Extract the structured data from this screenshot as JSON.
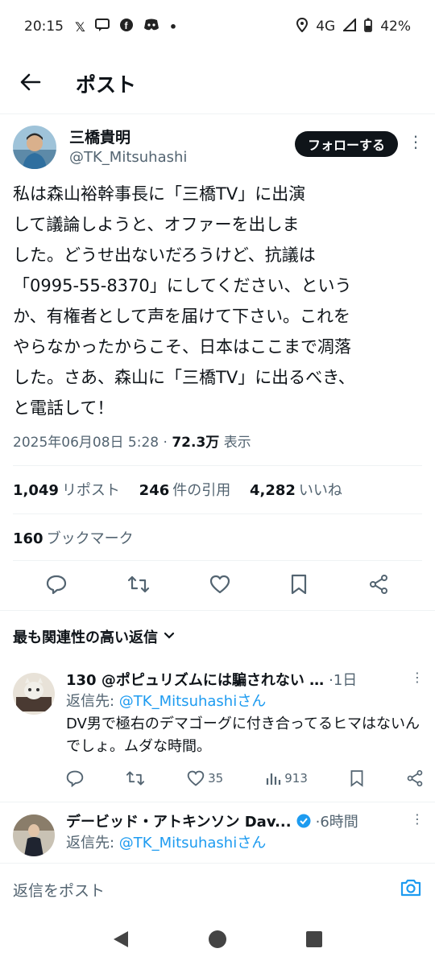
{
  "status": {
    "time": "20:15",
    "network": "4G",
    "battery": "42%"
  },
  "header": {
    "title": "ポスト"
  },
  "post": {
    "author_name": "三橋貴明",
    "author_handle": "@TK_Mitsuhashi",
    "follow_label": "フォローする",
    "text": "私は森山裕幹事長に「三橋TV」に出演\nして議論しようと、オファーを出しま\nした。どうせ出ないだろうけど、抗議は\n「0995-55-8370」にしてください、という\nか、有権者として声を届けて下さい。これを\nやらなかったからこそ、日本はここまで凋落\nした。さあ、森山に「三橋TV」に出るべき、\nと電話して！",
    "datetime": "2025年06月08日 5:28",
    "separator": "·",
    "views": "72.3万",
    "views_label": "表示",
    "reposts": "1,049",
    "reposts_label": "リポスト",
    "quotes": "246",
    "quotes_label": "件の引用",
    "likes": "4,282",
    "likes_label": "いいね",
    "bookmarks": "160",
    "bookmarks_label": "ブックマーク"
  },
  "replies_section": {
    "sort_label": "最も関連性の高い返信"
  },
  "replies": [
    {
      "name": "130 @ポピュリズムには騙されない …",
      "time": "·1日",
      "reply_to_prefix": "返信先: ",
      "reply_to_handle": "@TK_Mitsuhashiさん",
      "text": "DV男で極右のデマゴーグに付き合ってるヒマはないんでしょ。ムダな時間。",
      "likes": "35",
      "views": "913"
    },
    {
      "name": "デービッド・アトキンソン Dav...",
      "time": "·6時間",
      "reply_to_prefix": "返信先: ",
      "reply_to_handle": "@TK_Mitsuhashiさん"
    }
  ],
  "composer": {
    "placeholder": "返信をポスト"
  },
  "colors": {
    "accent": "#1d9bf0",
    "text": "#0f1419",
    "secondary": "#536471"
  }
}
